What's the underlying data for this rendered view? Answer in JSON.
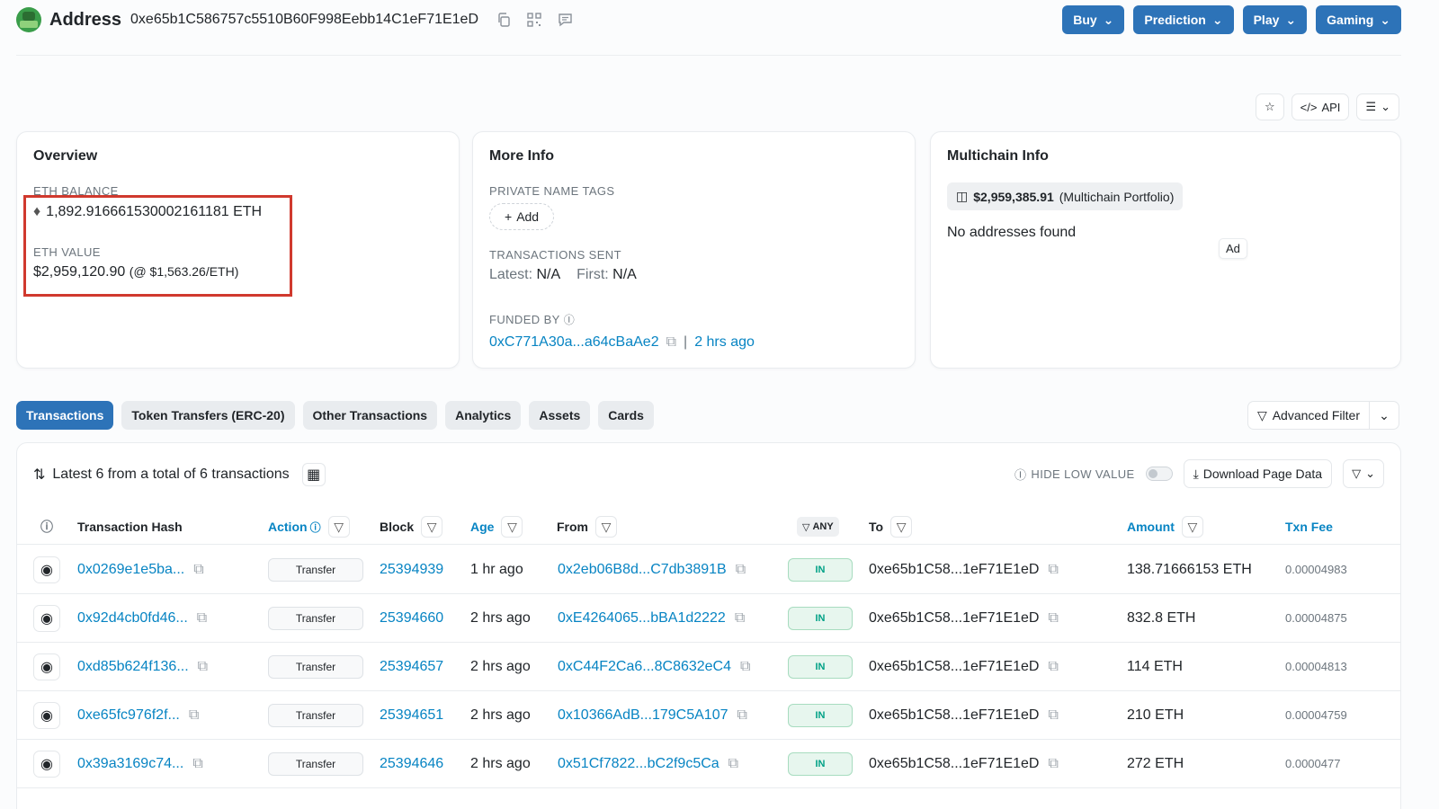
{
  "header": {
    "title": "Address",
    "address": "0xe65b1C586757c5510B60F998Eebb14C1eF71E1eD",
    "menus": [
      "Buy",
      "Prediction",
      "Play",
      "Gaming"
    ]
  },
  "toolbar": {
    "api_label": "API"
  },
  "overview": {
    "title": "Overview",
    "eth_balance_label": "ETH BALANCE",
    "eth_balance": "1,892.916661530002161181 ETH",
    "eth_value_label": "ETH VALUE",
    "eth_value": "$2,959,120.90",
    "eth_price": "(@ $1,563.26/ETH)"
  },
  "more_info": {
    "title": "More Info",
    "private_tags_label": "PRIVATE NAME TAGS",
    "add_label": "Add",
    "tx_sent_label": "TRANSACTIONS SENT",
    "latest_label": "Latest:",
    "latest_value": "N/A",
    "first_label": "First:",
    "first_value": "N/A",
    "funded_by_label": "FUNDED BY",
    "funded_by_address": "0xC771A30a...a64cBaAe2",
    "funded_by_age": "2 hrs ago"
  },
  "multichain": {
    "title": "Multichain Info",
    "portfolio_value": "$2,959,385.91",
    "portfolio_label": "(Multichain Portfolio)",
    "no_addresses": "No addresses found",
    "ad_label": "Ad"
  },
  "tabs": [
    "Transactions",
    "Token Transfers (ERC-20)",
    "Other Transactions",
    "Analytics",
    "Assets",
    "Cards"
  ],
  "advanced_filter_label": "Advanced Filter",
  "table": {
    "summary": "Latest 6 from a total of 6 transactions",
    "hide_low_value": "HIDE LOW VALUE",
    "download_label": "Download Page Data",
    "columns": {
      "hash": "Transaction Hash",
      "action": "Action",
      "block": "Block",
      "age": "Age",
      "from": "From",
      "any": "ANY",
      "to": "To",
      "amount": "Amount",
      "fee": "Txn Fee"
    },
    "rows": [
      {
        "hash": "0x0269e1e5ba...",
        "method": "Transfer",
        "block": "25394939",
        "age": "1 hr ago",
        "from": "0x2eb06B8d...C7db3891B",
        "direction": "IN",
        "to": "0xe65b1C58...1eF71E1eD",
        "amount": "138.71666153 ETH",
        "fee": "0.00004983"
      },
      {
        "hash": "0x92d4cb0fd46...",
        "method": "Transfer",
        "block": "25394660",
        "age": "2 hrs ago",
        "from": "0xE4264065...bBA1d2222",
        "direction": "IN",
        "to": "0xe65b1C58...1eF71E1eD",
        "amount": "832.8 ETH",
        "fee": "0.00004875"
      },
      {
        "hash": "0xd85b624f136...",
        "method": "Transfer",
        "block": "25394657",
        "age": "2 hrs ago",
        "from": "0xC44F2Ca6...8C8632eC4",
        "direction": "IN",
        "to": "0xe65b1C58...1eF71E1eD",
        "amount": "114 ETH",
        "fee": "0.00004813"
      },
      {
        "hash": "0xe65fc976f2f...",
        "method": "Transfer",
        "block": "25394651",
        "age": "2 hrs ago",
        "from": "0x10366AdB...179C5A107",
        "direction": "IN",
        "to": "0xe65b1C58...1eF71E1eD",
        "amount": "210 ETH",
        "fee": "0.00004759"
      },
      {
        "hash": "0x39a3169c74...",
        "method": "Transfer",
        "block": "25394646",
        "age": "2 hrs ago",
        "from": "0x51Cf7822...bC2f9c5Ca",
        "direction": "IN",
        "to": "0xe65b1C58...1eF71E1eD",
        "amount": "272 ETH",
        "fee": "0.0000477"
      }
    ]
  }
}
